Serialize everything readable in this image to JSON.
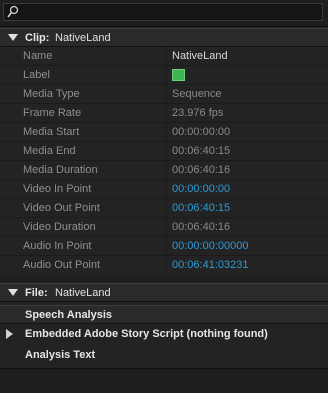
{
  "search": {
    "placeholder": "",
    "value": ""
  },
  "clip_section": {
    "title": "Clip:",
    "value": "NativeLand"
  },
  "rows": [
    {
      "label": "Name",
      "value": "NativeLand"
    },
    {
      "label": "Label",
      "value": ""
    },
    {
      "label": "Media Type",
      "value": "Sequence"
    },
    {
      "label": "Frame Rate",
      "value": "23.976 fps"
    },
    {
      "label": "Media Start",
      "value": "00:00:00:00"
    },
    {
      "label": "Media End",
      "value": "00:06:40:15"
    },
    {
      "label": "Media Duration",
      "value": "00:06:40:16"
    },
    {
      "label": "Video In Point",
      "value": "00:00:00:00"
    },
    {
      "label": "Video Out Point",
      "value": "00:06:40:15"
    },
    {
      "label": "Video Duration",
      "value": "00:06:40:16"
    },
    {
      "label": "Audio In Point",
      "value": "00:00:00:00000"
    },
    {
      "label": "Audio Out Point",
      "value": "00:06:41:03231"
    }
  ],
  "label_color": "#3fb551",
  "file_section": {
    "title": "File:",
    "value": "NativeLand"
  },
  "speech_analysis": {
    "title": "Speech Analysis",
    "embedded_script": "Embedded Adobe Story Script (nothing found)",
    "analysis_text": "Analysis Text"
  }
}
